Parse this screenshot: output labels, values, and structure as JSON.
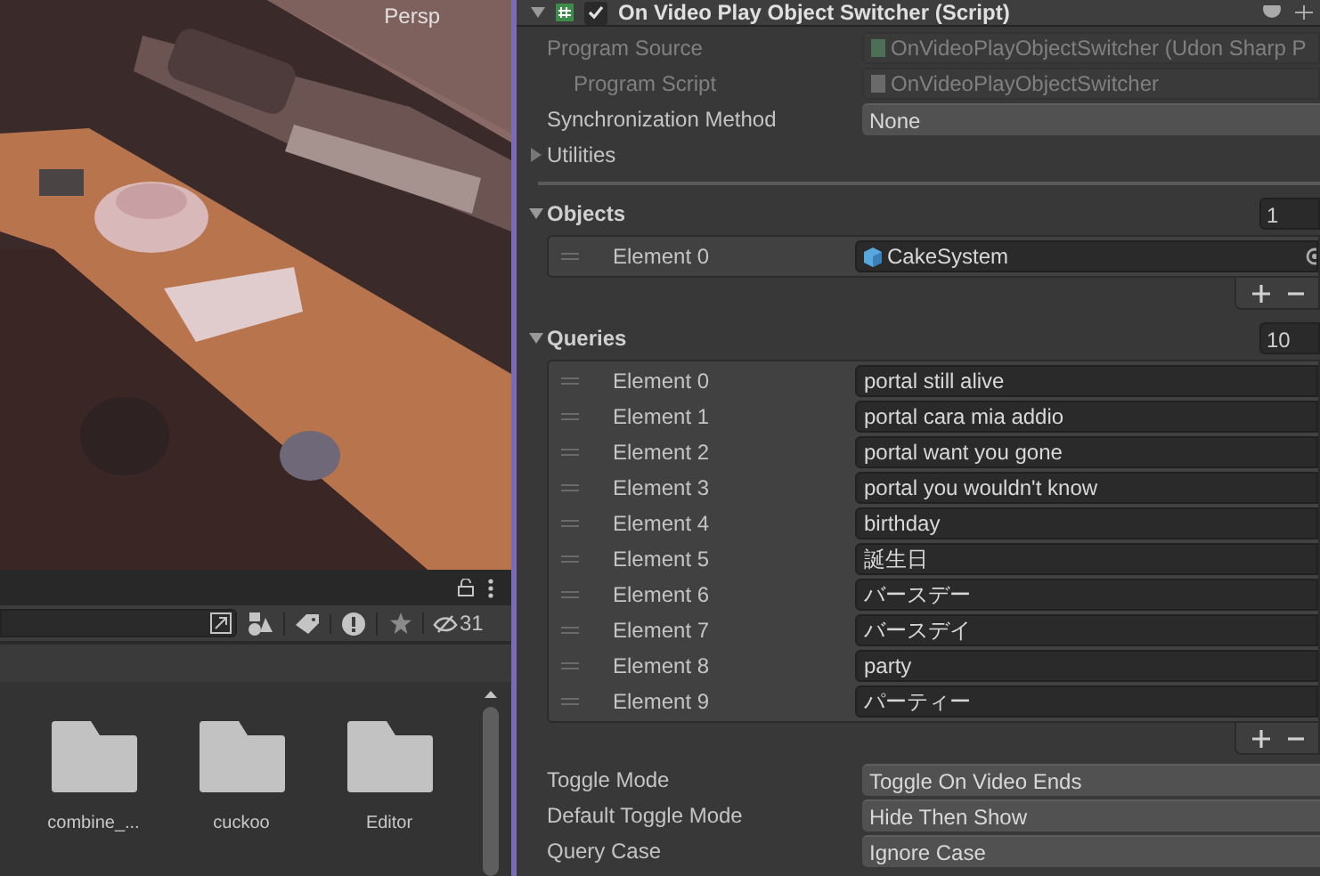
{
  "scene_view": {
    "camera_label": "Persp"
  },
  "project_panel": {
    "hidden_count": "31",
    "folders": [
      {
        "name": "combine_..."
      },
      {
        "name": "cuckoo"
      },
      {
        "name": "Editor"
      }
    ]
  },
  "inspector": {
    "component": {
      "title": "On Video Play Object Switcher (Script)",
      "enabled": true
    },
    "program_source": {
      "label": "Program Source",
      "value": "OnVideoPlayObjectSwitcher (Udon Sharp P"
    },
    "program_script": {
      "label": "Program Script",
      "value": "OnVideoPlayObjectSwitcher"
    },
    "sync_method": {
      "label": "Synchronization Method",
      "value": "None"
    },
    "utilities": {
      "label": "Utilities",
      "expanded": false
    },
    "objects": {
      "label": "Objects",
      "expanded": true,
      "count": "1",
      "elements": [
        {
          "label": "Element 0",
          "value": "CakeSystem"
        }
      ]
    },
    "queries": {
      "label": "Queries",
      "expanded": true,
      "count": "10",
      "elements": [
        {
          "label": "Element 0",
          "value": "portal still alive"
        },
        {
          "label": "Element 1",
          "value": "portal cara mia addio"
        },
        {
          "label": "Element 2",
          "value": "portal want you gone"
        },
        {
          "label": "Element 3",
          "value": "portal you wouldn't know"
        },
        {
          "label": "Element 4",
          "value": "birthday"
        },
        {
          "label": "Element 5",
          "value": "誕生日"
        },
        {
          "label": "Element 6",
          "value": "バースデー"
        },
        {
          "label": "Element 7",
          "value": "バースデイ"
        },
        {
          "label": "Element 8",
          "value": "party"
        },
        {
          "label": "Element 9",
          "value": "パーティー"
        }
      ]
    },
    "settings": [
      {
        "label": "Toggle Mode",
        "value": "Toggle On Video Ends"
      },
      {
        "label": "Default Toggle Mode",
        "value": "Hide Then Show"
      },
      {
        "label": "Query Case",
        "value": "Ignore Case"
      }
    ]
  }
}
